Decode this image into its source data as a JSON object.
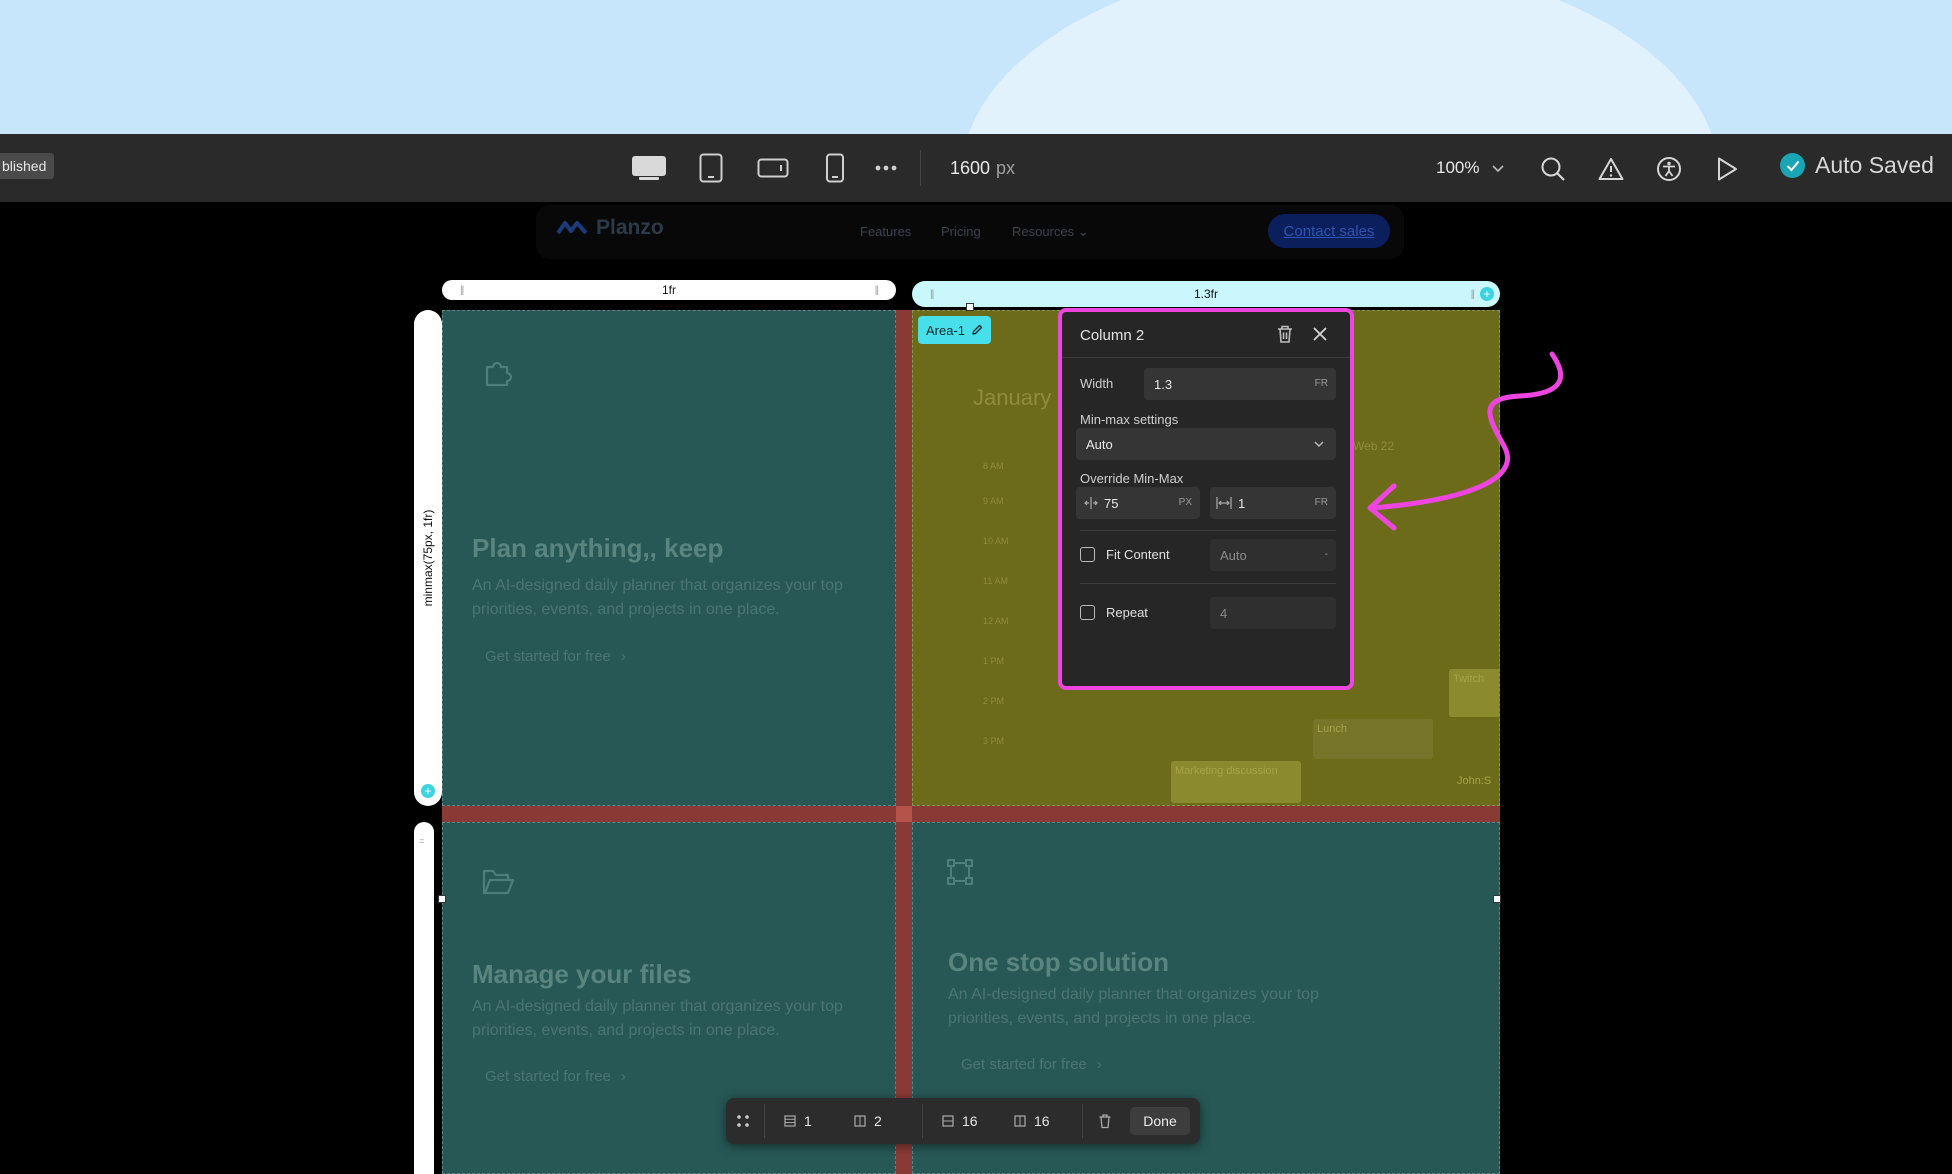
{
  "toolbar": {
    "publish_status": "blished",
    "canvas_width_value": "1600",
    "canvas_width_unit": "px",
    "zoom": "100%",
    "autosave_label": "Auto Saved"
  },
  "site": {
    "logo_text": "Planzo",
    "nav_links": [
      "Features",
      "Pricing",
      "Resources"
    ],
    "contact_label": "Contact sales"
  },
  "grid": {
    "column1_label": "1fr",
    "column2_label": "1.3fr",
    "row1_label": "minmax(75px, 1fr)",
    "area_tag": "Area-1"
  },
  "cards": {
    "card1": {
      "title": "Plan anything,, keep",
      "desc": "An AI-designed daily planner that organizes your top priorities, events, and projects in one place.",
      "cta": "Get started for free"
    },
    "card2": {
      "title": "Manage your files",
      "desc": "An AI-designed daily planner that organizes your top priorities, events, and projects in one place.",
      "cta": "Get started for free"
    },
    "card3": {
      "title": "One stop solution",
      "desc": "An AI-designed daily planner that organizes your top priorities, events, and projects in one place.",
      "cta": "Get started for free"
    }
  },
  "calendar": {
    "month": "January",
    "day_label": "Web 22",
    "times": [
      "8 AM",
      "9 AM",
      "10 AM",
      "11 AM",
      "12 AM",
      "1 PM",
      "2 PM",
      "3 PM"
    ],
    "events": [
      "Twitch",
      "Lunch",
      "Marketing discussion",
      "John:S"
    ]
  },
  "popover": {
    "title": "Column 2",
    "width_label": "Width",
    "width_value": "1.3",
    "width_unit": "FR",
    "minmax_label": "Min-max settings",
    "minmax_value": "Auto",
    "override_label": "Override Min-Max",
    "override_min_value": "75",
    "override_min_unit": "PX",
    "override_max_value": "1",
    "override_max_unit": "FR",
    "fit_content_label": "Fit Content",
    "fit_content_value": "Auto",
    "repeat_label": "Repeat",
    "repeat_value": "4"
  },
  "bottom_bar": {
    "rows_value": "1",
    "cols_value": "2",
    "row_gap_value": "16",
    "col_gap_value": "16",
    "done_label": "Done"
  },
  "colors": {
    "accent_magenta": "#ee45e0",
    "accent_cyan": "#47dfe9",
    "cell_teal": "#275856",
    "cell_selected": "#6c6b1a",
    "gap_red": "#8a3a35"
  }
}
